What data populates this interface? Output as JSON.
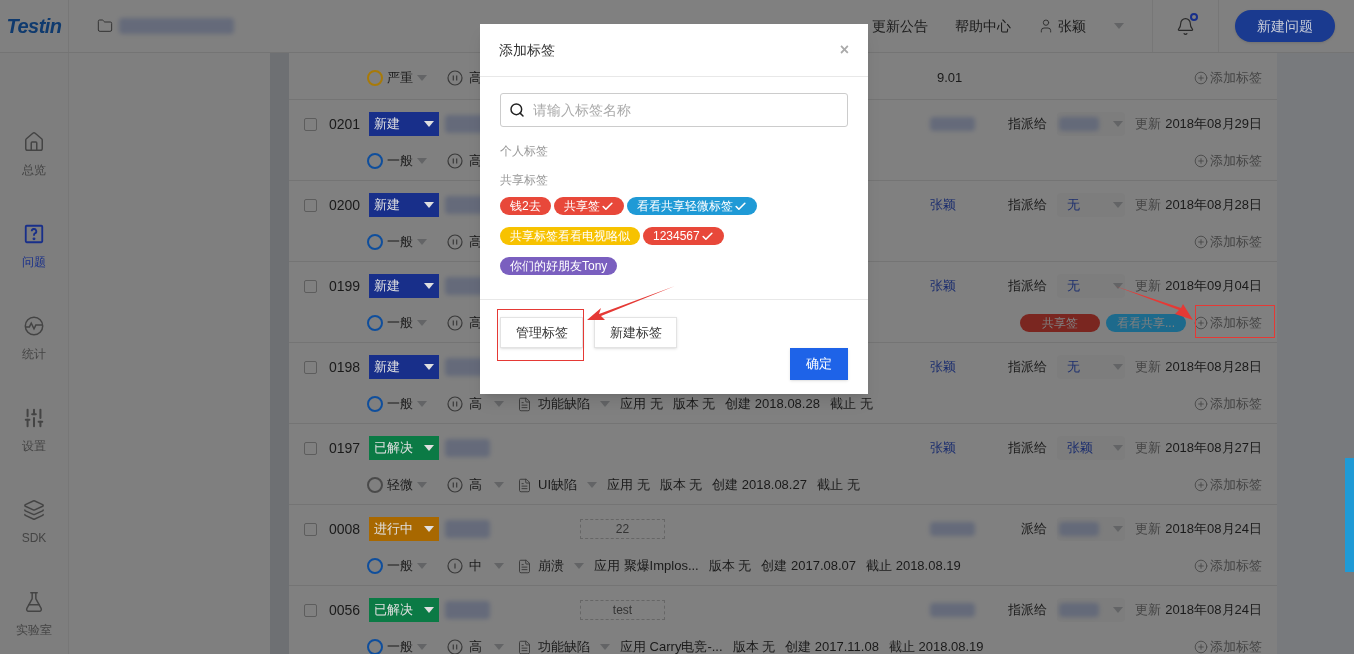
{
  "header": {
    "logo": "Testin",
    "links": [
      "更新公告",
      "帮助中心"
    ],
    "user": "张颖",
    "notification_dot": true,
    "new_button": "新建问题"
  },
  "sidebar": {
    "items": [
      {
        "label": "总览",
        "kind": "home",
        "selected": false
      },
      {
        "label": "问题",
        "kind": "question",
        "selected": true
      },
      {
        "label": "统计",
        "kind": "stats",
        "selected": false
      },
      {
        "label": "设置",
        "kind": "sliders",
        "selected": false
      },
      {
        "label": "SDK",
        "kind": "layers",
        "selected": false
      },
      {
        "label": "实验室",
        "kind": "flask",
        "selected": false
      }
    ]
  },
  "rows": [
    {
      "kind": "partial",
      "severity": {
        "label": "严重",
        "color": "#a87a08"
      },
      "priority": {
        "label": "高",
        "kind": "high"
      },
      "meta_fragment": "9.01",
      "add_tag": "添加标签"
    },
    {
      "kind": "full",
      "checked": false,
      "id": "0201",
      "status": {
        "label": "新建",
        "color": "#182f8a"
      },
      "assignee_label": "指派给",
      "updated_label": "更新",
      "updated": "2018年08月29日",
      "severity": {
        "label": "一般",
        "color": "#0f4e9c"
      },
      "priority": {
        "label": "高",
        "kind": "high"
      },
      "add_tag": "添加标签"
    },
    {
      "kind": "full",
      "checked": false,
      "id": "0200",
      "status": {
        "label": "新建",
        "color": "#182f8a"
      },
      "reporter": "张颖",
      "assignee_label": "指派给",
      "assignee": "无",
      "updated_label": "更新",
      "updated": "2018年08月28日",
      "severity": {
        "label": "一般",
        "color": "#0f4e9c"
      },
      "priority": {
        "label": "高",
        "kind": "high"
      },
      "add_tag": "添加标签"
    },
    {
      "kind": "full",
      "checked": false,
      "id": "0199",
      "status": {
        "label": "新建",
        "color": "#182f8a"
      },
      "reporter": "张颖",
      "assignee_label": "指派给",
      "assignee": "无",
      "updated_label": "更新",
      "updated": "2018年09月04日",
      "severity": {
        "label": "一般",
        "color": "#0f4e9c"
      },
      "priority": {
        "label": "高",
        "kind": "high"
      },
      "tags": [
        {
          "label": "共享签",
          "color": "#7a2620"
        },
        {
          "label": "看看共享...",
          "color": "#1d6a8c"
        }
      ],
      "add_tag": "添加标签"
    },
    {
      "kind": "full",
      "checked": false,
      "id": "0198",
      "status": {
        "label": "新建",
        "color": "#182f8a"
      },
      "reporter": "张颖",
      "assignee_label": "指派给",
      "assignee": "无",
      "updated_label": "更新",
      "updated": "2018年08月28日",
      "severity": {
        "label": "一般",
        "color": "#0f4e9c"
      },
      "priority": {
        "label": "高",
        "kind": "high"
      },
      "type": "功能缺陷",
      "meta": [
        "应用 无",
        "版本 无",
        "创建 2018.08.28",
        "截止 无"
      ],
      "add_tag": "添加标签"
    },
    {
      "kind": "full",
      "checked": false,
      "id": "0197",
      "status": {
        "label": "已解决",
        "color": "#0b7a45"
      },
      "reporter": "张颖",
      "assignee_label": "指派给",
      "assignee": "张颖",
      "updated_label": "更新",
      "updated": "2018年08月27日",
      "severity": {
        "label": "轻微",
        "color": "#4a4a4a"
      },
      "priority": {
        "label": "高",
        "kind": "high"
      },
      "type": "UI缺陷",
      "meta": [
        "应用 无",
        "版本 无",
        "创建 2018.08.27",
        "截止 无"
      ],
      "add_tag": "添加标签"
    },
    {
      "kind": "full",
      "checked": false,
      "id": "0008",
      "status": {
        "label": "进行中",
        "color": "#a86800"
      },
      "field": "22",
      "assignee_label": "派给",
      "updated_label": "更新",
      "updated": "2018年08月24日",
      "severity": {
        "label": "一般",
        "color": "#0f4e9c"
      },
      "priority": {
        "label": "中",
        "kind": "medium"
      },
      "type": "崩溃",
      "meta": [
        "应用 聚爆Implos...",
        "版本 无",
        "创建 2017.08.07",
        "截止 2018.08.19"
      ],
      "add_tag": "添加标签"
    },
    {
      "kind": "full",
      "checked": false,
      "id": "0056",
      "status": {
        "label": "已解决",
        "color": "#0b7a45"
      },
      "field": "test",
      "assignee_label": "指派给",
      "updated_label": "更新",
      "updated": "2018年08月24日",
      "severity": {
        "label": "一般",
        "color": "#0f4e9c"
      },
      "priority": {
        "label": "高",
        "kind": "high"
      },
      "type": "功能缺陷",
      "meta": [
        "应用 Carry电竞-...",
        "版本 无",
        "创建 2017.11.08",
        "截止 2018.08.19"
      ],
      "add_tag": "添加标签"
    }
  ],
  "dialog": {
    "title": "添加标签",
    "close": "×",
    "search": {
      "placeholder": "请输入标签名称"
    },
    "sections": [
      "个人标签",
      "共享标签"
    ],
    "tags": [
      {
        "label": "钱2去",
        "color": "#e8483a",
        "checked": false
      },
      {
        "label": "共享签",
        "color": "#e8483a",
        "checked": true
      },
      {
        "label": "看看共享轻微标签",
        "color": "#1f9ad6",
        "checked": true
      },
      {
        "label": "共享标签看看电视咯似",
        "color": "#f7c200",
        "checked": false
      },
      {
        "label": "1234567",
        "color": "#e8483a",
        "checked": true
      },
      {
        "label": "你们的好朋友Tony",
        "color": "#7a5fbf",
        "checked": false
      }
    ],
    "buttons": [
      "管理标签",
      "新建标签"
    ],
    "confirm": "确定"
  }
}
